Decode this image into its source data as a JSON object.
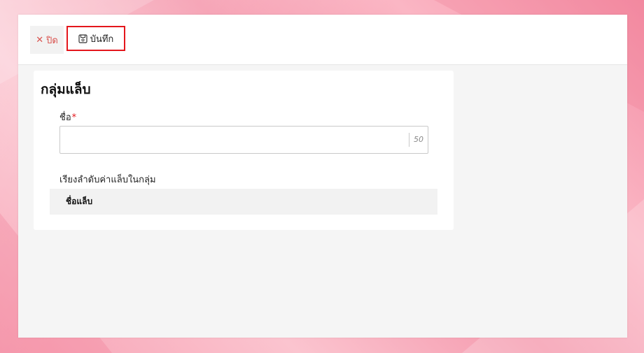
{
  "toolbar": {
    "close_label": "ปิด",
    "close_icon": "close-icon",
    "save_label": "บันทึก",
    "save_icon": "save-icon"
  },
  "form": {
    "title": "กลุ่มแล็บ",
    "name_label": "ชื่อ",
    "required_mark": "*",
    "name_value": "",
    "name_max_length": "50",
    "sort_label": "เรียงลำดับค่าแล็บในกลุ่ม",
    "lab_table": {
      "columns": [
        "ชื่อแล็บ"
      ],
      "rows": []
    }
  },
  "colors": {
    "accent_red": "#e4161c",
    "close_text": "#d9534f",
    "background_pink": "#f7a3b5"
  }
}
